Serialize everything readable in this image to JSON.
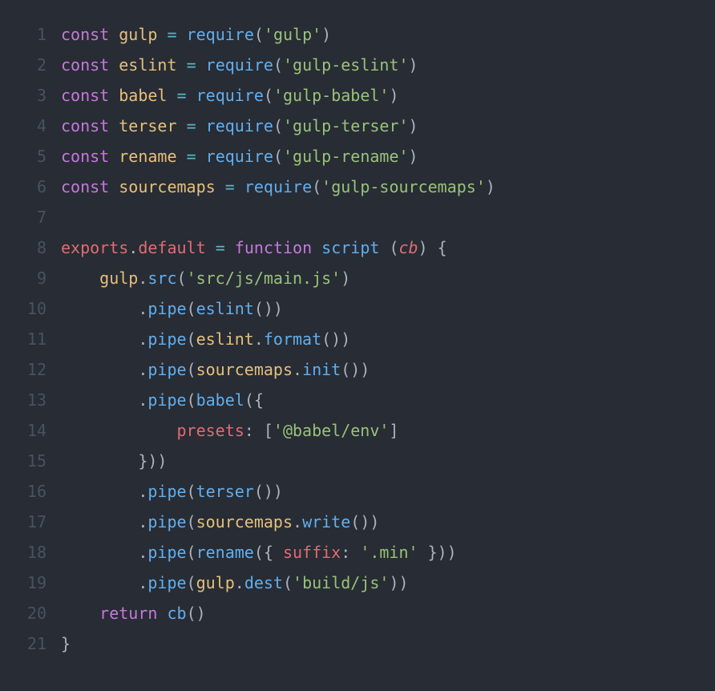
{
  "language": "javascript",
  "theme": "one-dark",
  "lines": [
    {
      "n": 1,
      "tokens": [
        [
          "kw",
          "const"
        ],
        [
          "punc",
          " "
        ],
        [
          "var",
          "gulp"
        ],
        [
          "punc",
          " "
        ],
        [
          "op",
          "="
        ],
        [
          "punc",
          " "
        ],
        [
          "fn",
          "require"
        ],
        [
          "punc",
          "("
        ],
        [
          "str",
          "'gulp'"
        ],
        [
          "punc",
          ")"
        ]
      ]
    },
    {
      "n": 2,
      "tokens": [
        [
          "kw",
          "const"
        ],
        [
          "punc",
          " "
        ],
        [
          "var",
          "eslint"
        ],
        [
          "punc",
          " "
        ],
        [
          "op",
          "="
        ],
        [
          "punc",
          " "
        ],
        [
          "fn",
          "require"
        ],
        [
          "punc",
          "("
        ],
        [
          "str",
          "'gulp-eslint'"
        ],
        [
          "punc",
          ")"
        ]
      ]
    },
    {
      "n": 3,
      "tokens": [
        [
          "kw",
          "const"
        ],
        [
          "punc",
          " "
        ],
        [
          "var",
          "babel"
        ],
        [
          "punc",
          " "
        ],
        [
          "op",
          "="
        ],
        [
          "punc",
          " "
        ],
        [
          "fn",
          "require"
        ],
        [
          "punc",
          "("
        ],
        [
          "str",
          "'gulp-babel'"
        ],
        [
          "punc",
          ")"
        ]
      ]
    },
    {
      "n": 4,
      "tokens": [
        [
          "kw",
          "const"
        ],
        [
          "punc",
          " "
        ],
        [
          "var",
          "terser"
        ],
        [
          "punc",
          " "
        ],
        [
          "op",
          "="
        ],
        [
          "punc",
          " "
        ],
        [
          "fn",
          "require"
        ],
        [
          "punc",
          "("
        ],
        [
          "str",
          "'gulp-terser'"
        ],
        [
          "punc",
          ")"
        ]
      ]
    },
    {
      "n": 5,
      "tokens": [
        [
          "kw",
          "const"
        ],
        [
          "punc",
          " "
        ],
        [
          "var",
          "rename"
        ],
        [
          "punc",
          " "
        ],
        [
          "op",
          "="
        ],
        [
          "punc",
          " "
        ],
        [
          "fn",
          "require"
        ],
        [
          "punc",
          "("
        ],
        [
          "str",
          "'gulp-rename'"
        ],
        [
          "punc",
          ")"
        ]
      ]
    },
    {
      "n": 6,
      "tokens": [
        [
          "kw",
          "const"
        ],
        [
          "punc",
          " "
        ],
        [
          "var",
          "sourcemaps"
        ],
        [
          "punc",
          " "
        ],
        [
          "op",
          "="
        ],
        [
          "punc",
          " "
        ],
        [
          "fn",
          "require"
        ],
        [
          "punc",
          "("
        ],
        [
          "str",
          "'gulp-sourcemaps'"
        ],
        [
          "punc",
          ")"
        ]
      ]
    },
    {
      "n": 7,
      "tokens": []
    },
    {
      "n": 8,
      "tokens": [
        [
          "def",
          "exports"
        ],
        [
          "punc",
          "."
        ],
        [
          "def",
          "default"
        ],
        [
          "punc",
          " "
        ],
        [
          "op",
          "="
        ],
        [
          "punc",
          " "
        ],
        [
          "kw",
          "function"
        ],
        [
          "punc",
          " "
        ],
        [
          "fn",
          "script"
        ],
        [
          "punc",
          " ("
        ],
        [
          "param",
          "cb"
        ],
        [
          "punc",
          ") {"
        ]
      ]
    },
    {
      "n": 9,
      "tokens": [
        [
          "punc",
          "    "
        ],
        [
          "var",
          "gulp"
        ],
        [
          "punc",
          "."
        ],
        [
          "fn",
          "src"
        ],
        [
          "punc",
          "("
        ],
        [
          "str",
          "'src/js/main.js'"
        ],
        [
          "punc",
          ")"
        ]
      ]
    },
    {
      "n": 10,
      "tokens": [
        [
          "punc",
          "        ."
        ],
        [
          "fn",
          "pipe"
        ],
        [
          "punc",
          "("
        ],
        [
          "fn",
          "eslint"
        ],
        [
          "punc",
          "())"
        ]
      ]
    },
    {
      "n": 11,
      "tokens": [
        [
          "punc",
          "        ."
        ],
        [
          "fn",
          "pipe"
        ],
        [
          "punc",
          "("
        ],
        [
          "var",
          "eslint"
        ],
        [
          "punc",
          "."
        ],
        [
          "fn",
          "format"
        ],
        [
          "punc",
          "())"
        ]
      ]
    },
    {
      "n": 12,
      "tokens": [
        [
          "punc",
          "        ."
        ],
        [
          "fn",
          "pipe"
        ],
        [
          "punc",
          "("
        ],
        [
          "var",
          "sourcemaps"
        ],
        [
          "punc",
          "."
        ],
        [
          "fn",
          "init"
        ],
        [
          "punc",
          "())"
        ]
      ]
    },
    {
      "n": 13,
      "tokens": [
        [
          "punc",
          "        ."
        ],
        [
          "fn",
          "pipe"
        ],
        [
          "punc",
          "("
        ],
        [
          "fn",
          "babel"
        ],
        [
          "punc",
          "({"
        ]
      ]
    },
    {
      "n": 14,
      "tokens": [
        [
          "punc",
          "            "
        ],
        [
          "prop",
          "presets"
        ],
        [
          "punc",
          ": ["
        ],
        [
          "str",
          "'@babel/env'"
        ],
        [
          "punc",
          "]"
        ]
      ]
    },
    {
      "n": 15,
      "tokens": [
        [
          "punc",
          "        }))"
        ]
      ]
    },
    {
      "n": 16,
      "tokens": [
        [
          "punc",
          "        ."
        ],
        [
          "fn",
          "pipe"
        ],
        [
          "punc",
          "("
        ],
        [
          "fn",
          "terser"
        ],
        [
          "punc",
          "())"
        ]
      ]
    },
    {
      "n": 17,
      "tokens": [
        [
          "punc",
          "        ."
        ],
        [
          "fn",
          "pipe"
        ],
        [
          "punc",
          "("
        ],
        [
          "var",
          "sourcemaps"
        ],
        [
          "punc",
          "."
        ],
        [
          "fn",
          "write"
        ],
        [
          "punc",
          "())"
        ]
      ]
    },
    {
      "n": 18,
      "tokens": [
        [
          "punc",
          "        ."
        ],
        [
          "fn",
          "pipe"
        ],
        [
          "punc",
          "("
        ],
        [
          "fn",
          "rename"
        ],
        [
          "punc",
          "({ "
        ],
        [
          "prop",
          "suffix"
        ],
        [
          "punc",
          ": "
        ],
        [
          "str",
          "'.min'"
        ],
        [
          "punc",
          " }))"
        ]
      ]
    },
    {
      "n": 19,
      "tokens": [
        [
          "punc",
          "        ."
        ],
        [
          "fn",
          "pipe"
        ],
        [
          "punc",
          "("
        ],
        [
          "var",
          "gulp"
        ],
        [
          "punc",
          "."
        ],
        [
          "fn",
          "dest"
        ],
        [
          "punc",
          "("
        ],
        [
          "str",
          "'build/js'"
        ],
        [
          "punc",
          "))"
        ]
      ]
    },
    {
      "n": 20,
      "tokens": [
        [
          "punc",
          "    "
        ],
        [
          "kw",
          "return"
        ],
        [
          "punc",
          " "
        ],
        [
          "fn",
          "cb"
        ],
        [
          "punc",
          "()"
        ]
      ]
    },
    {
      "n": 21,
      "tokens": [
        [
          "punc",
          "}"
        ]
      ]
    }
  ]
}
